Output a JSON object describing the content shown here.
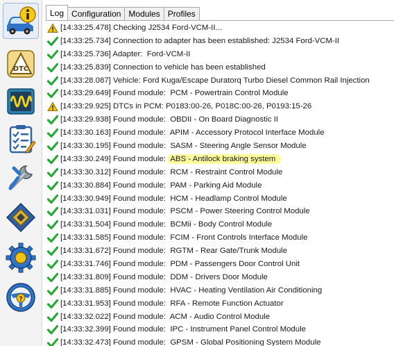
{
  "tabs": [
    {
      "label": "Log",
      "active": true
    },
    {
      "label": "Configuration",
      "active": false
    },
    {
      "label": "Modules",
      "active": false
    },
    {
      "label": "Profiles",
      "active": false
    }
  ],
  "sidebar": {
    "items": [
      {
        "name": "info-car-icon",
        "active": true
      },
      {
        "name": "dtc-icon",
        "active": false
      },
      {
        "name": "oscilloscope-icon",
        "active": false
      },
      {
        "name": "checklist-icon",
        "active": false
      },
      {
        "name": "wrench-icon",
        "active": false
      },
      {
        "name": "chip-icon",
        "active": false
      },
      {
        "name": "gear-icon",
        "active": false
      },
      {
        "name": "help-wheel-icon",
        "active": false
      }
    ]
  },
  "colors": {
    "check": "#27a835",
    "warning": "#f2c200",
    "highlight": "#fdfc9a"
  },
  "log": {
    "rows": [
      {
        "icon": "warning",
        "text": "[14:33:25.478] Checking J2534 Ford-VCM-II..."
      },
      {
        "icon": "check",
        "text": "[14:33:25.734] Connection to adapter has been established: J2534 Ford-VCM-II"
      },
      {
        "icon": "check",
        "text": "[14:33:25.736] Adapter:  Ford-VCM-II"
      },
      {
        "icon": "check",
        "text": "[14:33:25.839] Connection to vehicle has been established"
      },
      {
        "icon": "check",
        "text": "[14:33:28.087] Vehicle: Ford Kuga/Escape Duratorq Turbo Diesel Common Rail Injection"
      },
      {
        "icon": "check",
        "text": "[14:33:29.649] Found module:  PCM - Powertrain Control Module"
      },
      {
        "icon": "warning",
        "text": "[14:33:29.925] DTCs in PCM: P0183:00-26, P018C:00-26, P0193:15-26"
      },
      {
        "icon": "check",
        "text": "[14:33:29.938] Found module:  OBDII - On Board Diagnostic II"
      },
      {
        "icon": "check",
        "text": "[14:33:30.163] Found module:  APIM - Accessory Protocol Interface Module"
      },
      {
        "icon": "check",
        "text": "[14:33:30.195] Found module:  SASM - Steering Angle Sensor Module"
      },
      {
        "icon": "check",
        "prefix": "[14:33:30.249] Found module:  ",
        "highlight": "ABS - Antilock braking system"
      },
      {
        "icon": "check",
        "text": "[14:33:30.312] Found module:  RCM - Restraint Control Module"
      },
      {
        "icon": "check",
        "text": "[14:33:30.884] Found module:  PAM - Parking Aid Module"
      },
      {
        "icon": "check",
        "text": "[14:33:30.949] Found module:  HCM - Headlamp Control Module"
      },
      {
        "icon": "check",
        "text": "[14:33:31.031] Found module:  PSCM - Power Steering Control Module"
      },
      {
        "icon": "check",
        "text": "[14:33:31.504] Found module:  BCMii - Body Control Module"
      },
      {
        "icon": "check",
        "text": "[14:33:31.585] Found module:  FCIM - Front Controls Interface Module"
      },
      {
        "icon": "check",
        "text": "[14:33:31.672] Found module:  RGTM - Rear Gate/Trunk Module"
      },
      {
        "icon": "check",
        "text": "[14:33:31.746] Found module:  PDM - Passengers Door Control Unit"
      },
      {
        "icon": "check",
        "text": "[14:33:31.809] Found module:  DDM - Drivers Door Module"
      },
      {
        "icon": "check",
        "text": "[14:33:31.885] Found module:  HVAC - Heating Ventilation Air Conditioning"
      },
      {
        "icon": "check",
        "text": "[14:33:31.953] Found module:  RFA - Remote Function Actuator"
      },
      {
        "icon": "check",
        "text": "[14:33:32.022] Found module:  ACM - Audio Control Module"
      },
      {
        "icon": "check",
        "text": "[14:33:32.399] Found module:  IPC - Instrument Panel Control Module"
      },
      {
        "icon": "check",
        "text": "[14:33:32.473] Found module:  GPSM - Global Positioning System Module"
      }
    ]
  }
}
